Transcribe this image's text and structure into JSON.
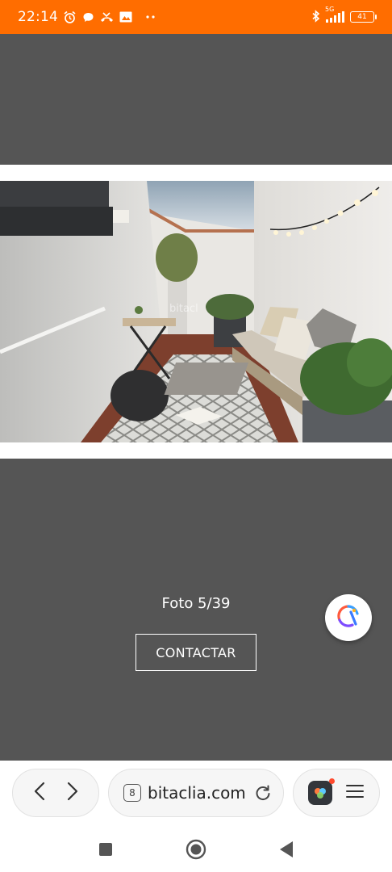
{
  "status_bar": {
    "time": "22:14",
    "network": "5G",
    "battery": "41"
  },
  "gallery": {
    "counter": "Foto 5/39",
    "contact_label": "CONTACTAR",
    "watermark": "bitacl"
  },
  "browser": {
    "tab_count": "8",
    "url": "bitaclia.com"
  },
  "icons": [
    "alarm-icon",
    "chat-icon",
    "missed-call-icon",
    "gallery-icon",
    "more-icon",
    "bluetooth-icon",
    "signal-icon",
    "battery-icon",
    "back-icon",
    "forward-icon",
    "reload-icon",
    "extension-icon",
    "menu-icon",
    "recents-icon",
    "home-icon",
    "nav-back-icon",
    "assistant-icon"
  ],
  "colors": {
    "status_bar": "#ff6d00",
    "background": "#555555"
  }
}
